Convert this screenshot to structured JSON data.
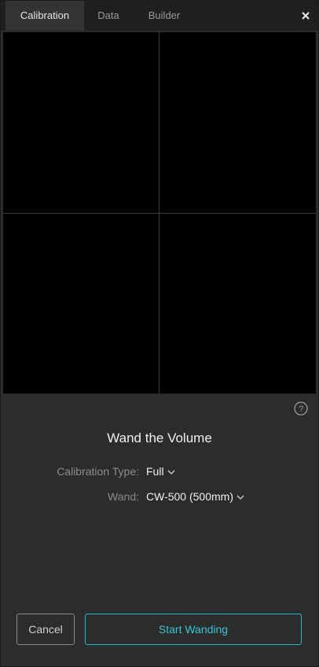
{
  "tabs": [
    {
      "label": "Calibration",
      "active": true
    },
    {
      "label": "Data",
      "active": false
    },
    {
      "label": "Builder",
      "active": false
    }
  ],
  "close_icon": "close-icon",
  "help_icon": "help-icon",
  "heading": "Wand the Volume",
  "fields": {
    "calibration_type": {
      "label": "Calibration Type:",
      "value": "Full"
    },
    "wand": {
      "label": "Wand:",
      "value": "CW-500 (500mm)"
    }
  },
  "buttons": {
    "cancel": "Cancel",
    "start": "Start Wanding"
  },
  "colors": {
    "accent": "#36c5d8",
    "panel_bg": "#2c2c2c",
    "viewport_bg": "#000000"
  }
}
